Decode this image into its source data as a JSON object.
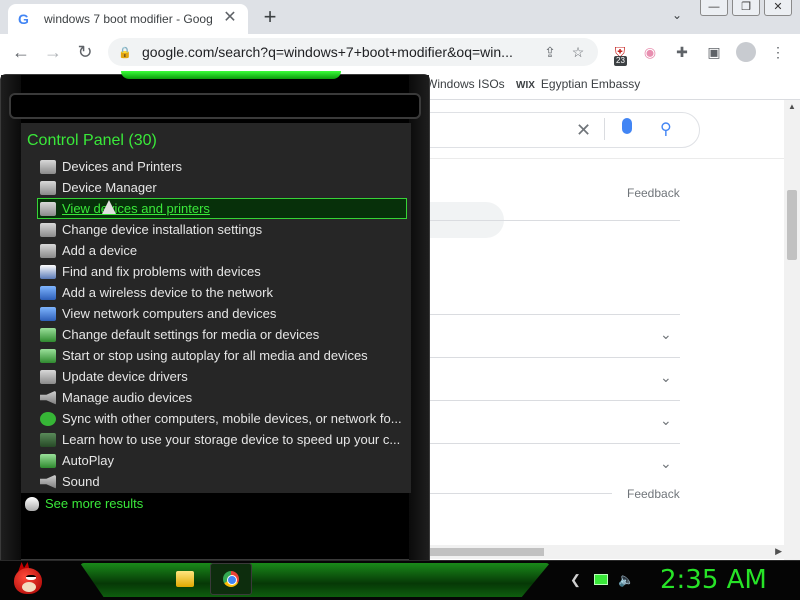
{
  "browser": {
    "tab_title": "windows 7 boot modifier - Goog",
    "tab_favicon": "G",
    "tab_close": "✕",
    "new_tab": "+",
    "tab_list": "⌄",
    "win_min": "—",
    "win_max": "❐",
    "win_close": "✕",
    "url": "google.com/search?q=windows+7+boot+modifier&oq=win...",
    "extension_badge": "23",
    "bookmarks": [
      {
        "label": "Windows ISOs"
      },
      {
        "label": "Egyptian Embassy",
        "icon_text": "WIX"
      }
    ]
  },
  "page": {
    "feedback_1": "Feedback",
    "feedback_2": "Feedback",
    "search_clear": "✕",
    "search_icon": "⚲",
    "chevron": "⌄"
  },
  "start_menu": {
    "header": "Control Panel (30)",
    "items": [
      {
        "label": "Devices and Printers",
        "icon": "device"
      },
      {
        "label": "Device Manager",
        "icon": "device"
      },
      {
        "label": "View devices and printers",
        "icon": "device",
        "selected": true
      },
      {
        "label": "Change device installation settings",
        "icon": "device"
      },
      {
        "label": "Add a device",
        "icon": "device"
      },
      {
        "label": "Find and fix problems with devices",
        "icon": "find"
      },
      {
        "label": "Add a wireless device to the network",
        "icon": "network"
      },
      {
        "label": "View network computers and devices",
        "icon": "network"
      },
      {
        "label": "Change default settings for media or devices",
        "icon": "media"
      },
      {
        "label": "Start or stop using autoplay for all media and devices",
        "icon": "media"
      },
      {
        "label": "Update device drivers",
        "icon": "device"
      },
      {
        "label": "Manage audio devices",
        "icon": "sound"
      },
      {
        "label": "Sync with other computers, mobile devices, or network fo...",
        "icon": "sync"
      },
      {
        "label": "Learn how to use your storage device to speed up your c...",
        "icon": "storage"
      },
      {
        "label": "AutoPlay",
        "icon": "media"
      },
      {
        "label": "Sound",
        "icon": "sound"
      }
    ],
    "see_more": "See more results"
  },
  "taskbar": {
    "clock": "2:35 AM",
    "tray_icons": [
      "tray-chevron-icon",
      "network-icon",
      "volume-icon"
    ],
    "tray_chevron": "❮",
    "tray_volume": "🔈"
  },
  "colors": {
    "accent_green": "#3ae83a",
    "clock_green": "#27e327",
    "menu_bg": "#262626"
  }
}
